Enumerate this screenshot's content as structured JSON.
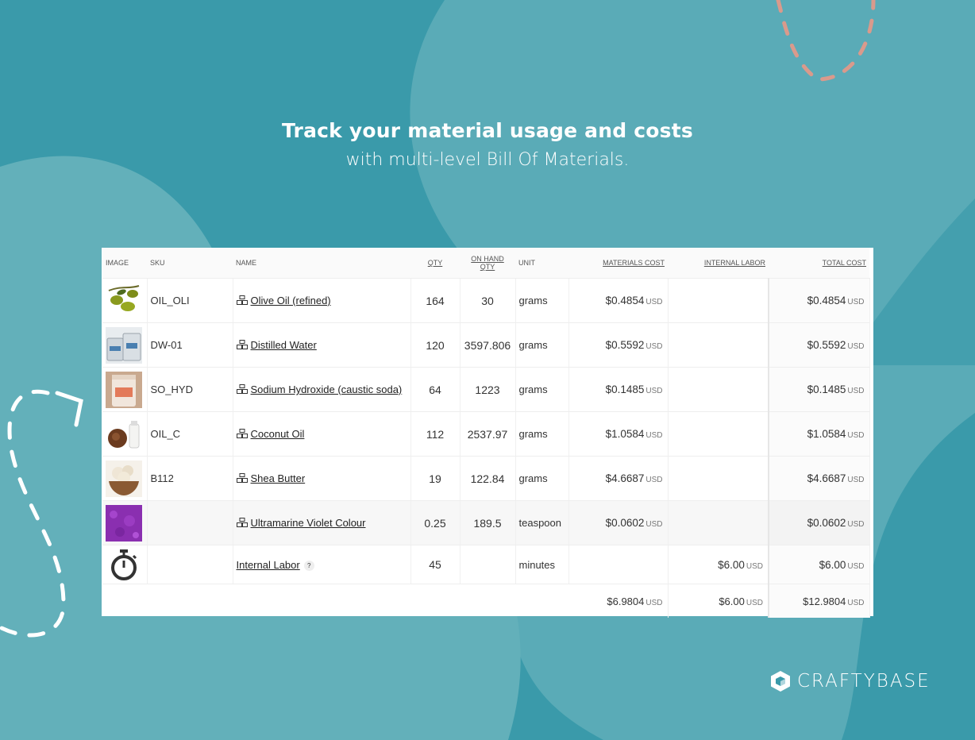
{
  "headline": {
    "line1": "Track your material usage and costs",
    "line2": "with multi-level Bill Of Materials."
  },
  "table": {
    "headers": {
      "image": "IMAGE",
      "sku": "SKU",
      "name": "NAME",
      "qty": "QTY",
      "on_hand": "ON HAND QTY",
      "unit": "UNIT",
      "materials_cost": "MATERIALS COST",
      "internal_labor": "INTERNAL LABOR",
      "total_cost": "TOTAL COST"
    },
    "rows": [
      {
        "sku": "OIL_OLI",
        "name": "Olive Oil (refined)",
        "qty": "164",
        "on_hand": "30",
        "unit": "grams",
        "materials_cost": "$0.4854",
        "total_cost": "$0.4854",
        "image": "olive-icon"
      },
      {
        "sku": "DW-01",
        "name": "Distilled Water",
        "qty": "120",
        "on_hand": "3597.806",
        "unit": "grams",
        "materials_cost": "$0.5592",
        "total_cost": "$0.5592",
        "image": "water-jug-icon"
      },
      {
        "sku": "SO_HYD",
        "name": "Sodium Hydroxide (caustic soda)",
        "qty": "64",
        "on_hand": "1223",
        "unit": "grams",
        "materials_cost": "$0.1485",
        "total_cost": "$0.1485",
        "image": "lye-jar-icon"
      },
      {
        "sku": "OIL_C",
        "name": "Coconut Oil",
        "qty": "112",
        "on_hand": "2537.97",
        "unit": "grams",
        "materials_cost": "$1.0584",
        "total_cost": "$1.0584",
        "image": "coconut-icon"
      },
      {
        "sku": "B112",
        "name": "Shea Butter",
        "qty": "19",
        "on_hand": "122.84",
        "unit": "grams",
        "materials_cost": "$4.6687",
        "total_cost": "$4.6687",
        "image": "shea-bowl-icon"
      },
      {
        "sku": "",
        "name": "Ultramarine Violet Colour",
        "qty": "0.25",
        "on_hand": "189.5",
        "unit": "teaspoon",
        "materials_cost": "$0.0602",
        "total_cost": "$0.0602",
        "image": "violet-powder-icon"
      }
    ],
    "labor": {
      "name": "Internal Labor",
      "help": "?",
      "qty": "45",
      "unit": "minutes",
      "internal_labor": "$6.00",
      "total_cost": "$6.00",
      "image": "stopwatch-icon"
    },
    "totals": {
      "materials_cost": "$6.9804",
      "internal_labor": "$6.00",
      "total_cost": "$12.9804"
    },
    "currency": "USD"
  },
  "brand": {
    "name": "CRAFTYBASE"
  },
  "colors": {
    "background": "#3a9aaa",
    "accent_dashes": "#d99a8c"
  }
}
